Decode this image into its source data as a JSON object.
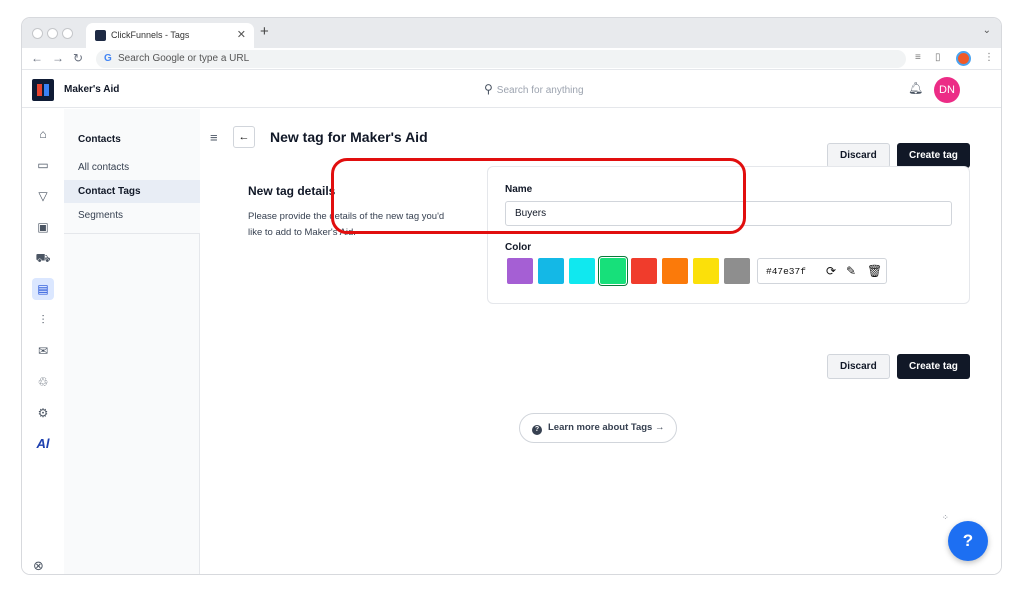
{
  "browser": {
    "tab_title": "ClickFunnels - Tags",
    "new_tab_icon": "+",
    "omnibox_placeholder": "Search Google or type a URL"
  },
  "app": {
    "org_name": "Maker's Aid",
    "search_placeholder": "Search for anything",
    "avatar_initials": "DN"
  },
  "subnav": {
    "title": "Contacts",
    "items": [
      {
        "label": "All contacts",
        "active": false
      },
      {
        "label": "Contact Tags",
        "active": true
      },
      {
        "label": "Segments",
        "active": false
      }
    ]
  },
  "page": {
    "title": "New tag for Maker's Aid",
    "discard_label": "Discard",
    "create_label": "Create tag",
    "section_title": "New tag details",
    "section_desc": "Please provide the details of the new tag you'd like to add to Maker's Aid."
  },
  "form": {
    "name_label": "Name",
    "name_value": "Buyers",
    "color_label": "Color",
    "colors": [
      "#a55fd4",
      "#14b8e6",
      "#10e8ef",
      "#17e07a",
      "#f03c2c",
      "#fb7a0a",
      "#fbe00a",
      "#8e8e8e"
    ],
    "selected_color_index": 3,
    "hex_value": "#47e37f"
  },
  "footer": {
    "learn_more_label": "Learn more about Tags"
  },
  "colors": {
    "primary_button": "#111827",
    "avatar": "#ec2c86",
    "highlight": "#e10e0e",
    "chat": "#1d6ff2"
  }
}
